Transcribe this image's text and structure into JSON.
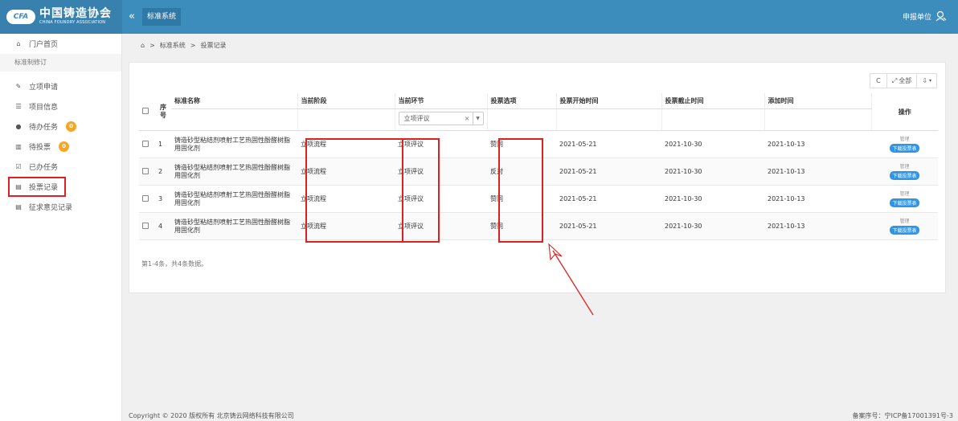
{
  "brand": {
    "mark": "CFA",
    "name_cn": "中国铸造协会",
    "name_en": "CHINA FOUNDRY ASSOCIATION"
  },
  "topnav": {
    "collapse": "«",
    "item": "标准系统",
    "user": "申报单位"
  },
  "sidebar": {
    "home": "门户首页",
    "sub": "标准制修订",
    "items": [
      {
        "label": "立项申请"
      },
      {
        "label": "项目信息"
      },
      {
        "label": "待办任务",
        "badge": "0"
      },
      {
        "label": "待投票",
        "badge": "0"
      },
      {
        "label": "已办任务"
      },
      {
        "label": "投票记录"
      },
      {
        "label": "征求意见记录"
      }
    ]
  },
  "breadcrumb": {
    "sep": ">",
    "level1": "标准系统",
    "level2": "投票记录"
  },
  "toolbar": {
    "refresh": "C",
    "all": "全部",
    "export": "⇩"
  },
  "table": {
    "headers": {
      "seq": "序号",
      "name": "标准名称",
      "stage": "当前阶段",
      "step": "当前环节",
      "option": "投票选项",
      "start": "投票开始时间",
      "end": "投票截止时间",
      "added": "添加时间",
      "action": "操作"
    },
    "filter": {
      "value": "立项评议",
      "clear": "×",
      "caret": "▼"
    },
    "rows": [
      {
        "seq": "1",
        "name": "铸造砂型粘结剂喷射工艺热固性酚醛树脂用固化剂",
        "stage": "立项流程",
        "step": "立项评议",
        "option": "赞同",
        "start": "2021-05-21",
        "end": "2021-10-30",
        "added": "2021-10-13",
        "manage": "管理",
        "download": "下载投票表"
      },
      {
        "seq": "2",
        "name": "铸造砂型粘结剂喷射工艺热固性酚醛树脂用固化剂",
        "stage": "立项流程",
        "step": "立项评议",
        "option": "反对",
        "start": "2021-05-21",
        "end": "2021-10-30",
        "added": "2021-10-13",
        "manage": "管理",
        "download": "下载投票表"
      },
      {
        "seq": "3",
        "name": "铸造砂型粘结剂喷射工艺热固性酚醛树脂用固化剂",
        "stage": "立项流程",
        "step": "立项评议",
        "option": "赞同",
        "start": "2021-05-21",
        "end": "2021-10-30",
        "added": "2021-10-13",
        "manage": "管理",
        "download": "下载投票表"
      },
      {
        "seq": "4",
        "name": "铸造砂型粘结剂喷射工艺热固性酚醛树脂用固化剂",
        "stage": "立项流程",
        "step": "立项评议",
        "option": "赞同",
        "start": "2021-05-21",
        "end": "2021-10-30",
        "added": "2021-10-13",
        "manage": "管理",
        "download": "下载投票表"
      }
    ],
    "summary": "第1-4条，共4条数据。"
  },
  "footer": {
    "copyright": "Copyright © 2020 版权所有 北京铸云网络科技有限公司",
    "icp": "备案序号：宁ICP备17001391号-3"
  },
  "colors": {
    "topbar": "#3c8dbc",
    "badge": "#f5a623",
    "highlight": "#e02020",
    "download_button": "#2f96e6"
  }
}
